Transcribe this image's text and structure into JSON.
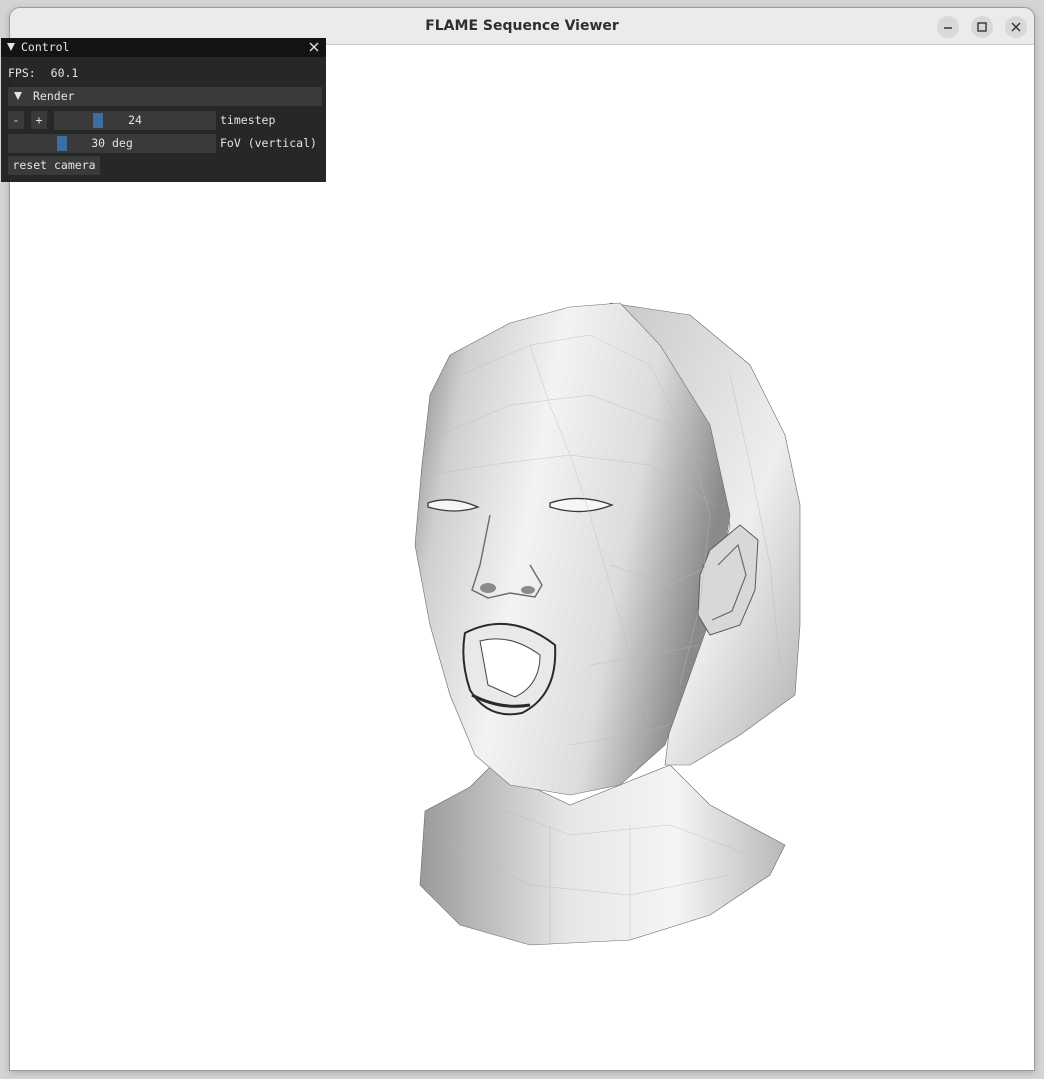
{
  "window": {
    "title": "FLAME Sequence Viewer",
    "controls": [
      "minimize-icon",
      "maximize-icon",
      "close-icon"
    ]
  },
  "control_panel": {
    "title": "Control",
    "fps_label": "FPS:",
    "fps_value": "60.1",
    "render_header": "Render",
    "timestep": {
      "minus_label": "-",
      "plus_label": "+",
      "value": "24",
      "label": "timestep"
    },
    "fov": {
      "value": "30 deg",
      "label": "FoV (vertical)"
    },
    "reset_camera_label": "reset camera"
  },
  "viewport": {
    "content": "3d-head-mesh",
    "colors": {
      "background": "#ffffff",
      "mesh_light": "#f2f2f2",
      "mesh_dark": "#505050",
      "slider_grab": "#3d6ea3"
    }
  }
}
